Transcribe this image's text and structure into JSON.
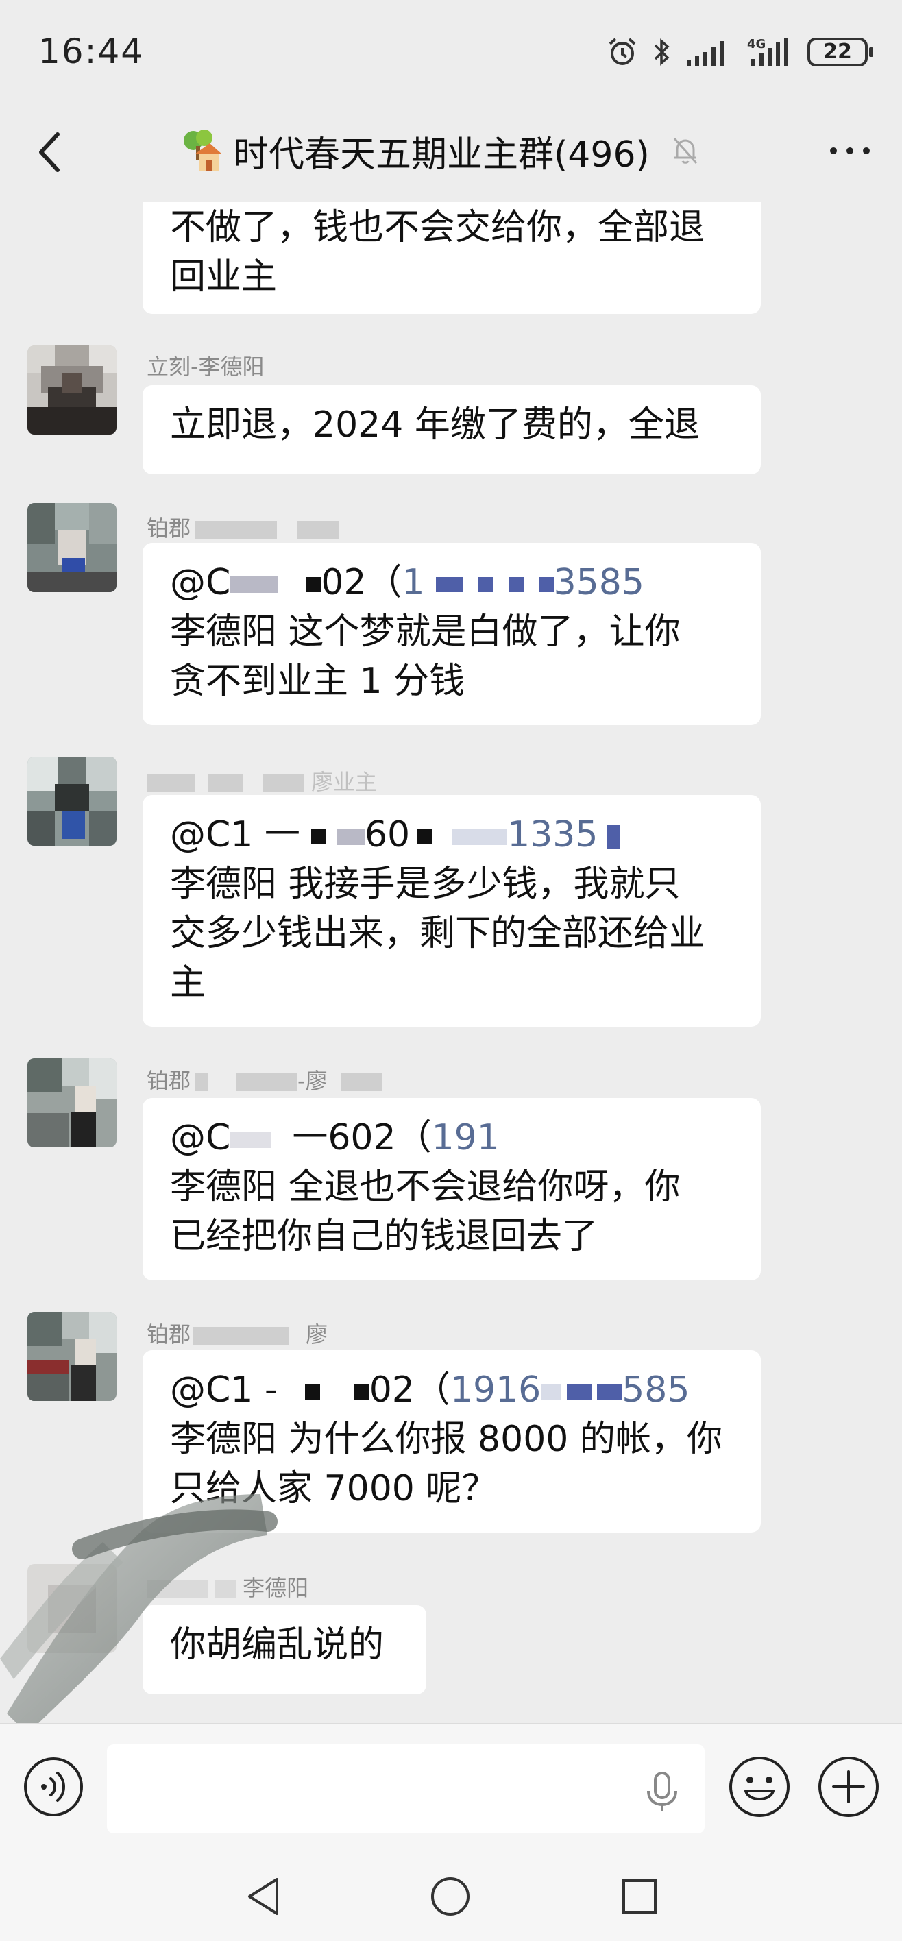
{
  "status_bar": {
    "time": "16:44",
    "battery": "22",
    "network": "4G"
  },
  "header": {
    "title": "时代春天五期业主群(496)"
  },
  "messages": [
    {
      "sender": "",
      "lines": [
        "不做了，钱也不会交给你，全部退",
        "回业主"
      ]
    },
    {
      "sender": "立刻-李德阳",
      "lines": [
        "立即退，2024 年缴了费的，全退"
      ]
    },
    {
      "sender": "铂郡",
      "at_prefix": "@C",
      "at_mid": "02（",
      "phone_start": "1",
      "phone_end": "3585",
      "lines": [
        "李德阳  这个梦就是白做了，让你",
        "贪不到业主 1 分钱"
      ]
    },
    {
      "sender": "廖业主",
      "at_prefix": "@C1 一",
      "at_mid": "60",
      "phone_end": "1335",
      "lines": [
        "李德阳  我接手是多少钱，我就只",
        "交多少钱出来，剩下的全部还给业",
        "主"
      ]
    },
    {
      "sender": "铂郡",
      "sender_end": "-廖",
      "at_prefix": "@C",
      "at_mid": "一602（",
      "phone_start": "191",
      "lines": [
        "李德阳  全退也不会退给你呀，你",
        "已经把你自己的钱退回去了"
      ]
    },
    {
      "sender": "铂郡",
      "sender_end": "廖",
      "at_prefix": "@C1 -",
      "at_mid": "02（",
      "phone_start": "1916",
      "phone_end": "585",
      "lines": [
        "李德阳  为什么你报 8000 的帐，你",
        "只给人家 7000 呢？"
      ]
    },
    {
      "sender": "李德阳",
      "lines": [
        "你胡编乱说的"
      ]
    }
  ]
}
